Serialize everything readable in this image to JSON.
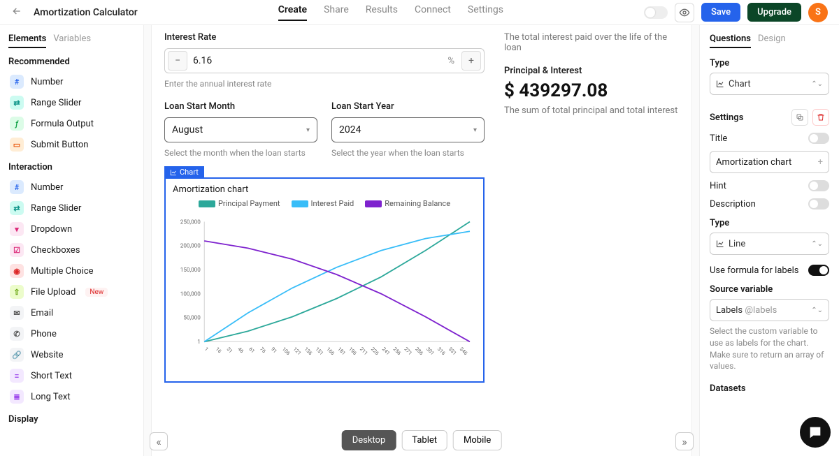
{
  "header": {
    "title": "Amortization Calculator",
    "nav": [
      "Create",
      "Share",
      "Results",
      "Connect",
      "Settings"
    ],
    "nav_active": 0,
    "save": "Save",
    "upgrade": "Upgrade",
    "avatar_initial": "S"
  },
  "left": {
    "tabs": [
      "Elements",
      "Variables"
    ],
    "sections": {
      "recommended": "Recommended",
      "interaction": "Interaction",
      "display": "Display"
    },
    "recommended_items": [
      "Number",
      "Range Slider",
      "Formula Output",
      "Submit Button"
    ],
    "interaction_items": [
      "Number",
      "Range Slider",
      "Dropdown",
      "Checkboxes",
      "Multiple Choice",
      "File Upload",
      "Email",
      "Phone",
      "Website",
      "Short Text",
      "Long Text"
    ],
    "new_badge": "New"
  },
  "canvas": {
    "interest_rate": {
      "label": "Interest Rate",
      "value": "6.16",
      "unit": "%",
      "help": "Enter the annual interest rate"
    },
    "loan_month": {
      "label": "Loan Start Month",
      "value": "August",
      "help": "Select the month when the loan starts"
    },
    "loan_year": {
      "label": "Loan Start Year",
      "value": "2024",
      "help": "Select the year when the loan starts"
    },
    "interest_paid_desc": "The total interest paid over the life of the loan",
    "pi_label": "Principal & Interest",
    "pi_amount": "$ 439297.08",
    "pi_desc": "The sum of total principal and total interest",
    "chart_title": "Amortization chart",
    "chart_tag": "Chart",
    "devices": [
      "Desktop",
      "Tablet",
      "Mobile"
    ]
  },
  "right": {
    "tabs": [
      "Questions",
      "Design"
    ],
    "type_label": "Type",
    "type_value": "Chart",
    "settings_label": "Settings",
    "title_label": "Title",
    "title_value": "Amortization chart",
    "hint_label": "Hint",
    "desc_label": "Description",
    "type2_value": "Line",
    "formula_label": "Use formula for labels",
    "source_label": "Source variable",
    "source_value": "Labels",
    "source_var": "@labels",
    "source_help": "Select the custom variable to use as labels for the chart. Make sure to return an array of values.",
    "datasets_label": "Datasets"
  },
  "chart_data": {
    "type": "line",
    "title": "Amortization chart",
    "xlabel": "",
    "ylabel": "",
    "ylim": [
      1,
      250000
    ],
    "y_ticks": [
      1,
      50000,
      100000,
      150000,
      200000,
      250000
    ],
    "x_ticks": [
      1,
      16,
      31,
      46,
      61,
      76,
      91,
      106,
      121,
      136,
      151,
      166,
      181,
      196,
      211,
      226,
      241,
      256,
      271,
      286,
      301,
      316,
      331,
      346
    ],
    "x": [
      1,
      60,
      120,
      180,
      240,
      300,
      360
    ],
    "series": [
      {
        "name": "Principal Payment",
        "color": "#2ca89a",
        "values": [
          1,
          22000,
          52000,
          90000,
          135000,
          190000,
          250000
        ]
      },
      {
        "name": "Interest Paid",
        "color": "#38bdf8",
        "values": [
          1,
          60000,
          112000,
          155000,
          190000,
          215000,
          230000
        ]
      },
      {
        "name": "Remaining Balance",
        "color": "#7e22ce",
        "values": [
          210000,
          195000,
          172000,
          140000,
          100000,
          52000,
          1
        ]
      }
    ]
  }
}
